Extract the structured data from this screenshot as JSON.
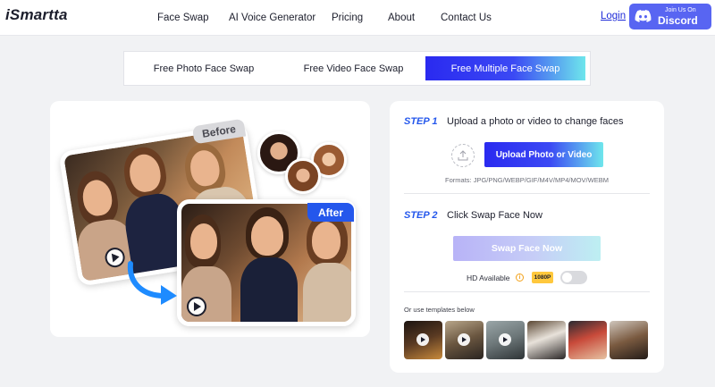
{
  "header": {
    "logo": "iSmartta",
    "nav": [
      "Face Swap",
      "AI Voice Generator",
      "Pricing",
      "About",
      "Contact Us"
    ],
    "login": "Login",
    "discord_top": "Join Us On",
    "discord_name": "Discord"
  },
  "tabs": [
    {
      "label": "Free Photo Face Swap",
      "active": false
    },
    {
      "label": "Free Video Face Swap",
      "active": false
    },
    {
      "label": "Free Multiple Face Swap",
      "active": true
    }
  ],
  "preview": {
    "before_label": "Before",
    "after_label": "After"
  },
  "step1": {
    "number": "STEP 1",
    "title": "Upload a photo or video to change faces",
    "button": "Upload Photo or Video",
    "formats": "Formats: JPG/PNG/WEBP/GIF/M4V/MP4/MOV/WEBM"
  },
  "step2": {
    "number": "STEP 2",
    "title": "Click Swap Face Now",
    "button": "Swap Face Now",
    "hd_label": "HD Available",
    "resolution": "1080P",
    "hd_enabled": false
  },
  "templates": {
    "label": "Or use templates below",
    "items": [
      {
        "icon": "play-icon",
        "has_play": true
      },
      {
        "icon": "play-icon",
        "has_play": true
      },
      {
        "icon": "play-icon",
        "has_play": true
      },
      {
        "icon": "none",
        "has_play": false
      },
      {
        "icon": "none",
        "has_play": false
      },
      {
        "icon": "none",
        "has_play": false
      }
    ]
  },
  "colors": {
    "accent": "#2457ec",
    "gradient_start": "#2a2af0",
    "gradient_end": "#6ee6ec",
    "discord": "#5865f2",
    "badge": "#ffc83d"
  }
}
